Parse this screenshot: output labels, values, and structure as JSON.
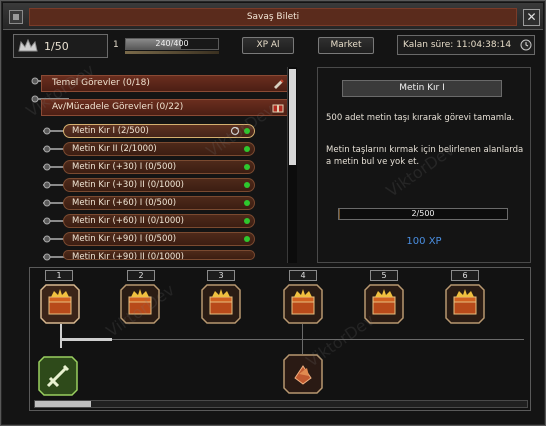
{
  "window": {
    "title": "Savaş Bileti",
    "close_glyph": "✕"
  },
  "topbar": {
    "level_text": "1/50",
    "xp_level": "1",
    "xp_text": "240/400",
    "xp_fraction": 0.6,
    "xp_button": "XP Al",
    "market_button": "Market",
    "timer_label": "Kalan süre:",
    "timer_value": "11:04:38:14"
  },
  "categories": [
    {
      "label": "Temel Görevler (0/18)",
      "icon": "pencil-icon"
    },
    {
      "label": "Av/Mücadele Görevleri (0/22)",
      "icon": "gift-icon"
    }
  ],
  "quests": [
    {
      "label": "Metin Kır I (2/500)",
      "selected": true
    },
    {
      "label": "Metin Kır II (2/1000)"
    },
    {
      "label": "Metin Kır (+30) I (0/500)"
    },
    {
      "label": "Metin Kır (+30) II (0/1000)"
    },
    {
      "label": "Metin Kır (+60) I (0/500)"
    },
    {
      "label": "Metin Kır (+60) II (0/1000)"
    },
    {
      "label": "Metin Kır (+90) I (0/500)"
    },
    {
      "label": "Metin Kır (+90) II (0/1000)"
    }
  ],
  "detail": {
    "title": "Metin Kır I",
    "description": "500 adet metin taşı kırarak görevi tamamla.",
    "hint": "Metin taşlarını kırmak için belirlenen alanlarda a metin bul ve yok et.",
    "progress_text": "2/500",
    "progress_fraction": 0.004,
    "reward": "100 XP"
  },
  "track": {
    "steps": [
      "1",
      "2",
      "3",
      "4",
      "5",
      "6"
    ]
  },
  "watermark": "ViktorDev",
  "colors": {
    "title_bar": "#5a2b1c",
    "quest_row": "#4e2a1a",
    "complete_dot": "#2ec82e",
    "reward_text": "#4a8ee0"
  }
}
